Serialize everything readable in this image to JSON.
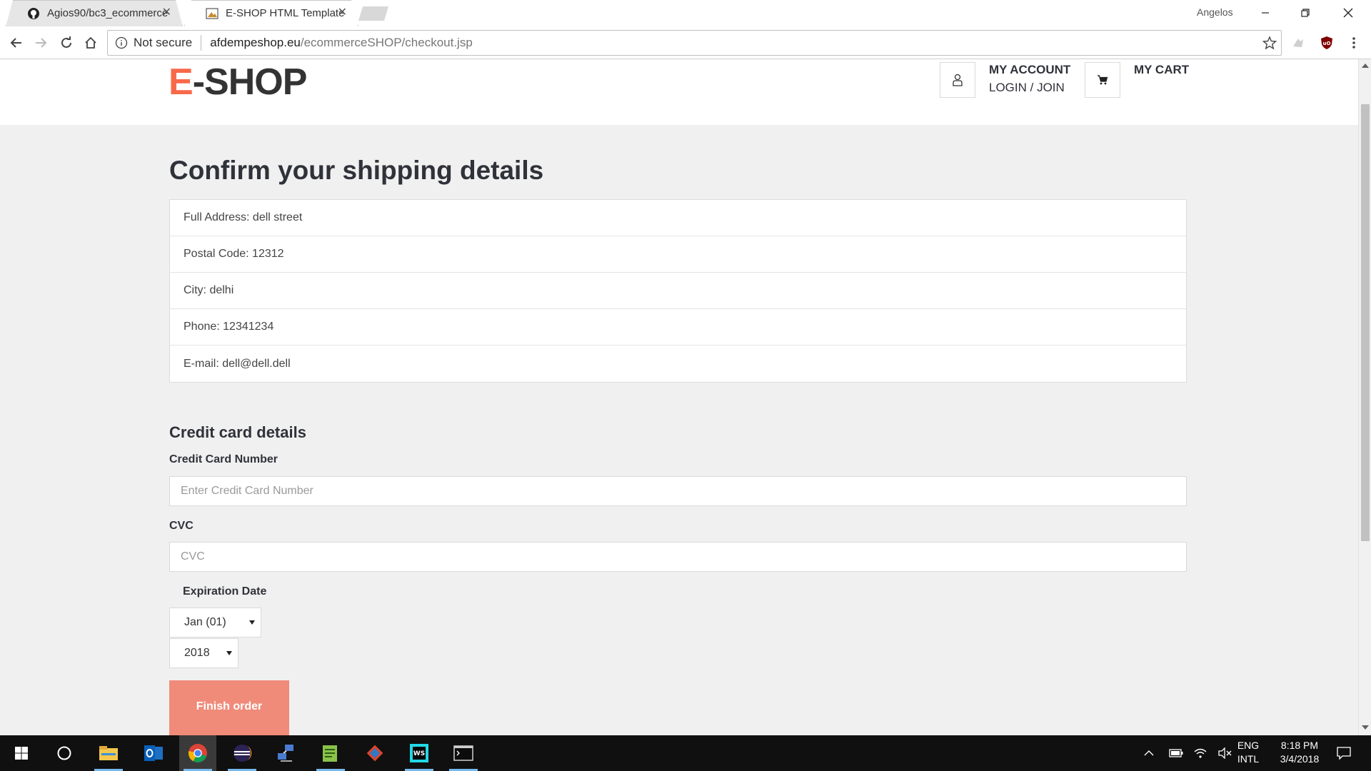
{
  "browser": {
    "tabs": [
      {
        "title": "Agios90/bc3_ecommerce",
        "icon": "github-icon"
      },
      {
        "title": "E-SHOP HTML Template",
        "icon": "page-favicon-icon"
      }
    ],
    "window_user": "Angelos",
    "url_security": "Not secure",
    "url_host": "afdempeshop.eu",
    "url_path": "/ecommerceSHOP/checkout.jsp"
  },
  "header": {
    "logo_accent": "E",
    "logo_rest": "-SHOP",
    "account_title": "MY ACCOUNT",
    "account_sub": "LOGIN / JOIN",
    "cart_title": "MY CART"
  },
  "checkout": {
    "title": "Confirm your shipping details",
    "details": [
      "Full Address: dell street",
      "Postal Code: 12312",
      "City: delhi",
      "Phone: 12341234",
      "E-mail: dell@dell.dell"
    ],
    "credit_section_title": "Credit card details",
    "card_number_label": "Credit Card Number",
    "card_number_placeholder": "Enter Credit Card Number",
    "cvc_label": "CVC",
    "cvc_placeholder": "CVC",
    "expiration_label": "Expiration Date",
    "month_value": "Jan (01)",
    "year_value": "2018",
    "finish_button": "Finish order"
  },
  "taskbar": {
    "language_1": "ENG",
    "language_2": "INTL",
    "time": "8:18 PM",
    "date": "3/4/2018"
  },
  "colors": {
    "brand_accent": "#f8694a",
    "finish_button": "#f08b7a",
    "page_background": "#f0f0f0",
    "heading_text": "#30323a"
  }
}
